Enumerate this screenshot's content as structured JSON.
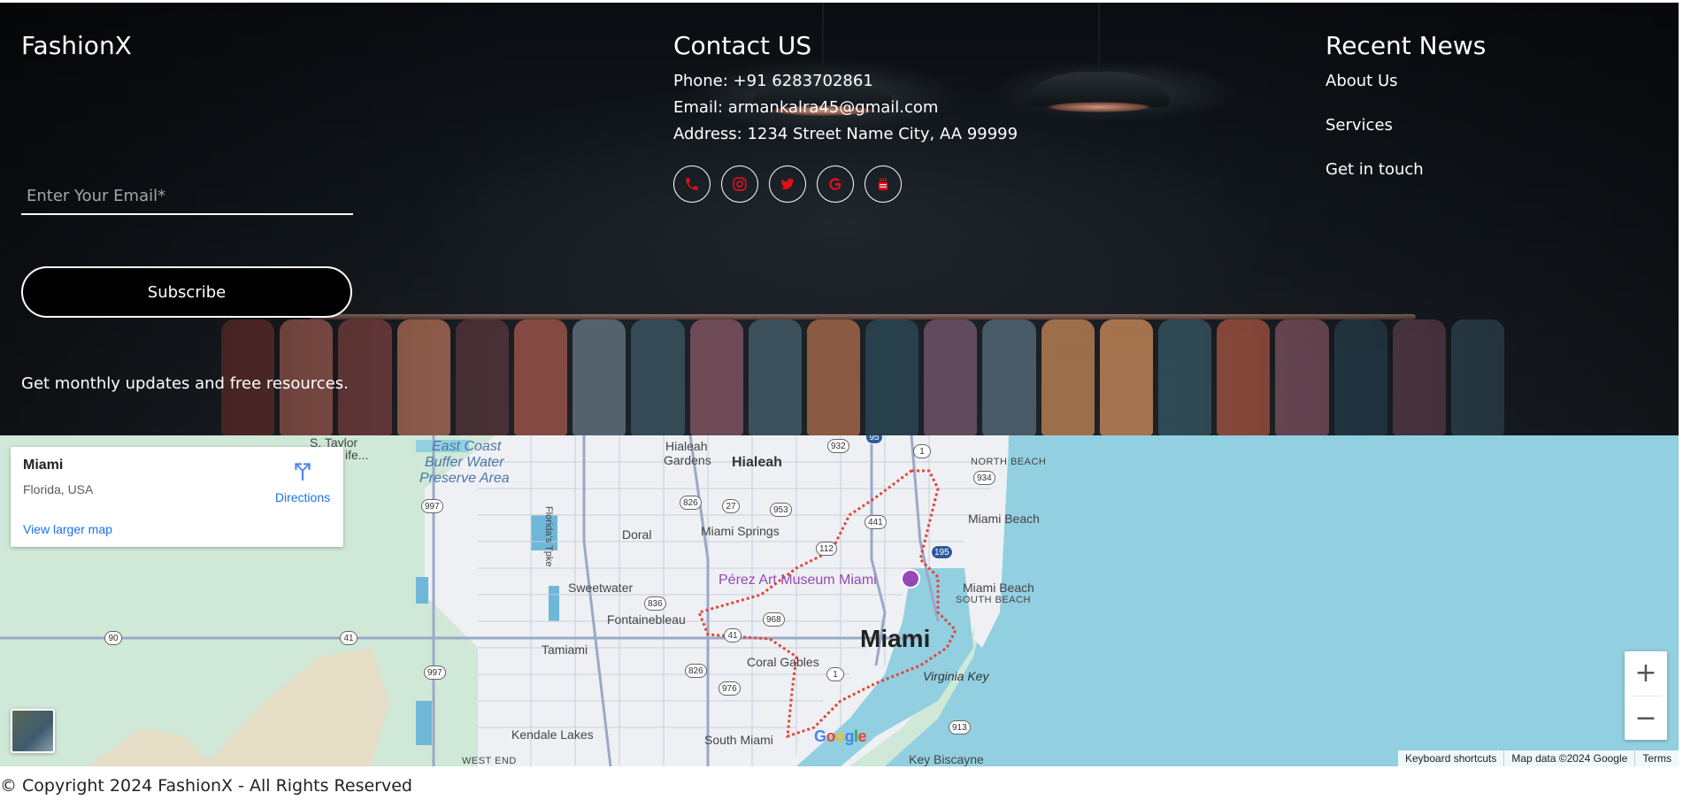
{
  "brand": "FashionX",
  "newsletter": {
    "placeholder": "Enter Your Email*",
    "subscribe_label": "Subscribe",
    "tagline": "Get monthly updates and free resources."
  },
  "contact": {
    "title": "Contact US",
    "phone": "Phone: +91 6283702861",
    "email": "Email: armankalra45@gmail.com",
    "address": "Address: 1234 Street Name City, AA 99999",
    "social_icons": [
      "phone-icon",
      "instagram-icon",
      "twitter-icon",
      "google-icon",
      "youtube-icon"
    ],
    "icon_color": "#e0101a"
  },
  "news": {
    "title": "Recent News",
    "links": [
      "About Us",
      "Services",
      "Get in touch"
    ]
  },
  "map": {
    "place": "Miami",
    "region": "Florida, USA",
    "directions": "Directions",
    "larger_map": "View larger map",
    "zoom_in": "+",
    "zoom_out": "−",
    "attribution": [
      "Keyboard shortcuts",
      "Map data ©2024 Google",
      "Terms"
    ],
    "google": "Google",
    "labels": {
      "s_taylor": "S. Taylor",
      "s_taylor2": "ife...",
      "ewc1": "East Coast",
      "ewc2": "Buffer Water",
      "ewc3": "Preserve Area",
      "hialeah_gardens1": "Hialeah",
      "hialeah_gardens2": "Gardens",
      "hialeah": "Hialeah",
      "north_beach": "NORTH BEACH",
      "doral": "Doral",
      "miami_springs": "Miami Springs",
      "miami_beach_top": "Miami Beach",
      "sweetwater": "Sweetwater",
      "perez": "Pérez Art Museum Miami",
      "miami_beach": "Miami Beach",
      "south_beach": "SOUTH BEACH",
      "fontainebleau": "Fontainebleau",
      "tamiami": "Tamiami",
      "miami": "Miami",
      "coral_gables": "Coral Gables",
      "virginia_key": "Virginia Key",
      "kendale": "Kendale Lakes",
      "south_miami": "South Miami",
      "west_end": "WEST END",
      "key_biscayne": "Key Biscayne",
      "florida_tpke": "Florida's Tpke"
    },
    "shields": {
      "s932": "932",
      "s1a": "1",
      "s934": "934",
      "s826a": "826",
      "s27": "27",
      "s953": "953",
      "s997a": "997",
      "s441": "441",
      "s112": "112",
      "s195": "195",
      "s836": "836",
      "s968": "968",
      "s41a": "41",
      "s90": "90",
      "s41b": "41",
      "s997b": "997",
      "s826b": "826",
      "s976": "976",
      "s1b": "1",
      "s913": "913",
      "s95": "95"
    }
  },
  "copyright": "© Copyright 2024 FashionX - All Rights Reserved"
}
